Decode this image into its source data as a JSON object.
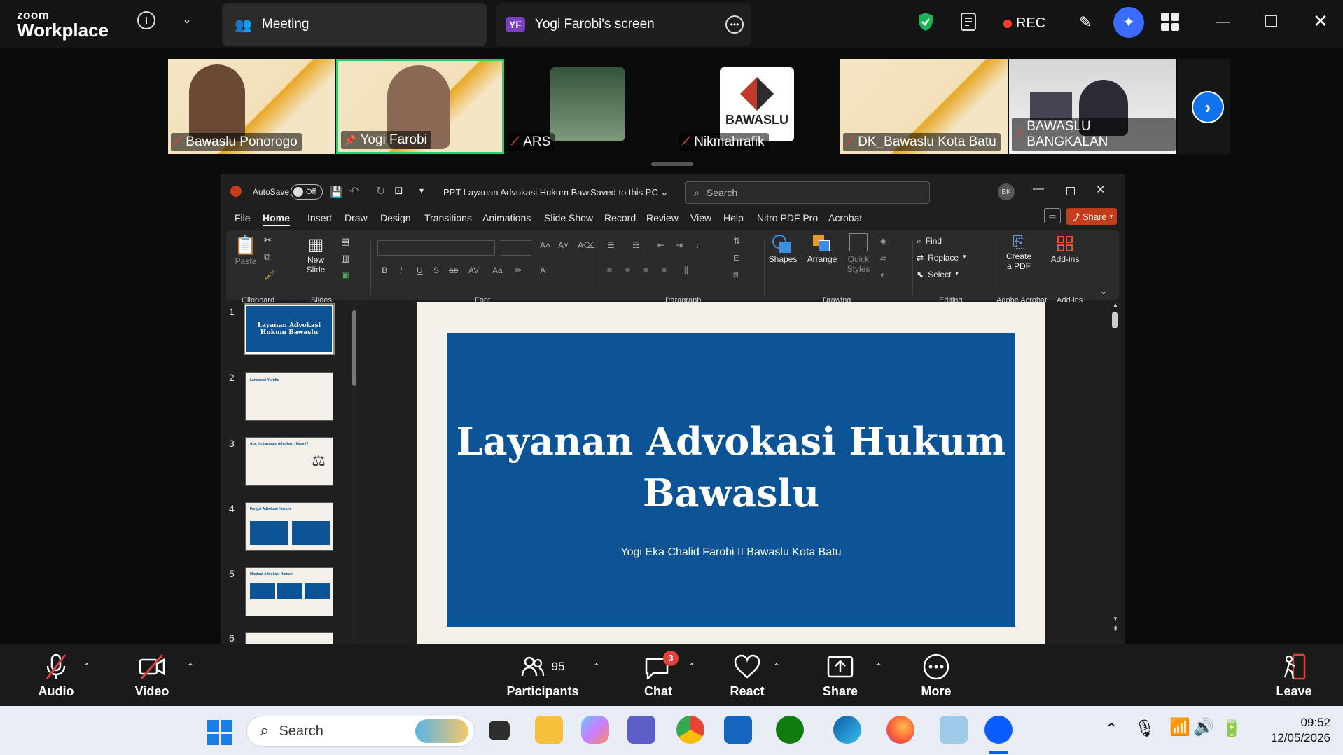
{
  "app": {
    "brand_top": "zoom",
    "brand_bottom": "Workplace"
  },
  "tabs": {
    "meeting": "Meeting",
    "screen_badge": "YF",
    "screen": "Yogi Farobi's screen"
  },
  "header": {
    "rec": "REC"
  },
  "participants_strip": [
    {
      "name": "Bawaslu Ponorogo",
      "muted": true
    },
    {
      "name": "Yogi Farobi",
      "muted": false,
      "active": true
    },
    {
      "name": "ARS",
      "muted": true
    },
    {
      "name": "Nikmahrafik",
      "muted": true,
      "logo": "BAWASLU"
    },
    {
      "name": "DK_Bawaslu Kota Batu",
      "muted": true
    },
    {
      "name": "BAWASLU BANGKALAN",
      "muted": true
    }
  ],
  "ppt": {
    "autosave": "AutoSave",
    "toggle": "Off",
    "file_title": "PPT Layanan Advokasi Hukum Baw...",
    "saved": "Saved to this PC",
    "search_placeholder": "Search",
    "avatar": "BK",
    "share": "Share",
    "menu": [
      "File",
      "Home",
      "Insert",
      "Draw",
      "Design",
      "Transitions",
      "Animations",
      "Slide Show",
      "Record",
      "Review",
      "View",
      "Help",
      "Nitro PDF Pro",
      "Acrobat"
    ],
    "ribbon": {
      "paste": "Paste",
      "new_slide_1": "New",
      "new_slide_2": "Slide",
      "groups": {
        "clipboard": "Clipboard",
        "slides": "Slides",
        "font": "Font",
        "paragraph": "Paragraph",
        "drawing": "Drawing",
        "editing": "Editing",
        "adobe": "Adobe Acrobat",
        "addins": "Add-ins"
      },
      "shapes": "Shapes",
      "arrange": "Arrange",
      "quick1": "Quick",
      "quick2": "Styles",
      "find": "Find",
      "replace": "Replace",
      "select": "Select",
      "create1": "Create",
      "create2": "a PDF",
      "addins_btn": "Add-ins",
      "font_btns": [
        "B",
        "I",
        "U",
        "S",
        "ab",
        "AV",
        "Aa"
      ]
    },
    "thumbnails": [
      {
        "num": "1",
        "title": "Layanan Advokasi Hukum Bawaslu"
      },
      {
        "num": "2",
        "title": "Landasan Yuridis"
      },
      {
        "num": "3",
        "title": "Apa itu Layanan Advokasi Hukum?"
      },
      {
        "num": "4",
        "title": "Fungsi Advokasi Hukum"
      },
      {
        "num": "5",
        "title": "Manfaat Advokasi Hukum"
      },
      {
        "num": "6",
        "title": ""
      }
    ],
    "slide": {
      "title_line1": "Layanan Advokasi Hukum",
      "title_line2": "Bawaslu",
      "subtitle": "Yogi Eka Chalid Farobi II Bawaslu Kota Batu"
    }
  },
  "controls": {
    "audio": "Audio",
    "video": "Video",
    "participants": "Participants",
    "participants_count": "95",
    "chat": "Chat",
    "chat_badge": "3",
    "react": "React",
    "share": "Share",
    "more": "More",
    "leave": "Leave"
  },
  "taskbar": {
    "search": "Search",
    "time": "09:52",
    "date": "12/05/2026"
  },
  "colors": {
    "slide_blue": "#0b5394",
    "active_border": "#2ecc71",
    "ppt_orange": "#c43e1c",
    "rec_red": "#ff3b30"
  }
}
